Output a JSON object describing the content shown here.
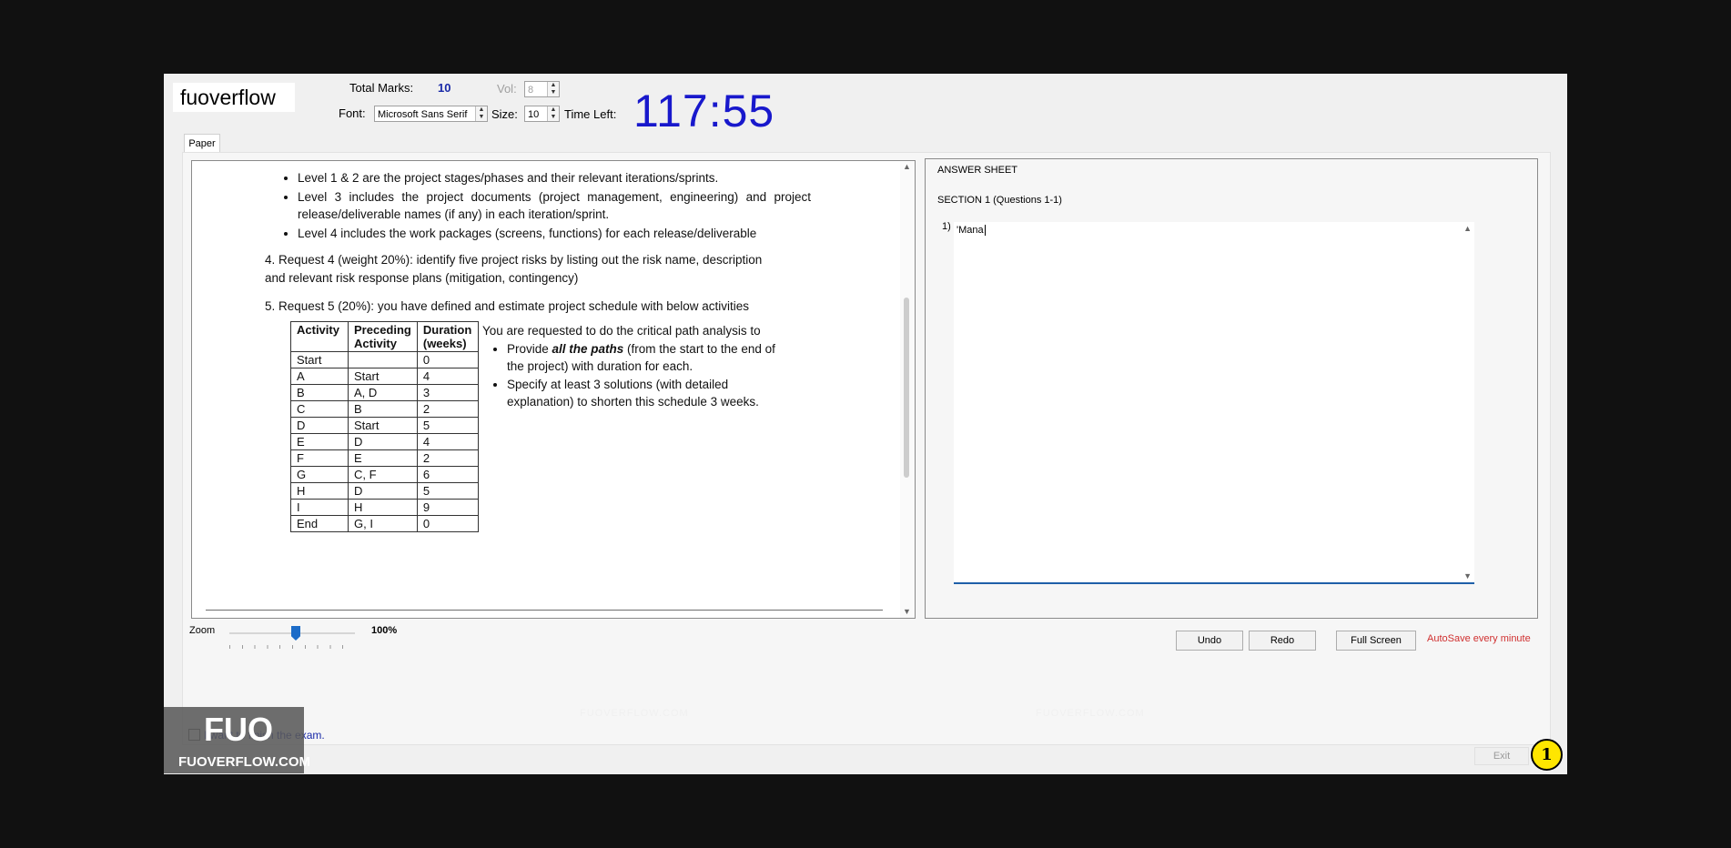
{
  "header": {
    "brand": "fuoverflow",
    "total_marks_label": "Total Marks:",
    "total_marks_value": "10",
    "vol_label": "Vol:",
    "vol_value": "8",
    "font_label": "Font:",
    "font_value": "Microsoft Sans Serif",
    "size_label": "Size:",
    "size_value": "10",
    "time_left_label": "Time Left:",
    "timer": "117:55"
  },
  "tabs": {
    "paper": "Paper"
  },
  "paper": {
    "bullets_top": [
      "Level 1 & 2 are the project stages/phases and their relevant iterations/sprints.",
      "Level 3 includes the project documents (project management, engineering) and project release/deliverable names (if any) in each iteration/sprint.",
      "Level 4 includes the work packages (screens, functions) for each release/deliverable"
    ],
    "request4": "4. Request 4 (weight 20%): identify five project risks by listing out the risk name, description and relevant risk response plans (mitigation, contingency)",
    "request5": "5. Request 5 (20%): you have defined and estimate project schedule with below activities",
    "table_headers": [
      "Activity",
      "Preceding Activity",
      "Duration (weeks)"
    ],
    "table_rows": [
      [
        "Start",
        "",
        "0"
      ],
      [
        "A",
        "Start",
        "4"
      ],
      [
        "B",
        "A, D",
        "3"
      ],
      [
        "C",
        "B",
        "2"
      ],
      [
        "D",
        "Start",
        "5"
      ],
      [
        "E",
        "D",
        "4"
      ],
      [
        "F",
        "E",
        "2"
      ],
      [
        "G",
        "C, F",
        "6"
      ],
      [
        "H",
        "D",
        "5"
      ],
      [
        "I",
        "H",
        "9"
      ],
      [
        "End",
        "G, I",
        "0"
      ]
    ],
    "cpa_intro": "You are requested to do the critical path analysis to",
    "cpa_b1_pre": "Provide ",
    "cpa_b1_em": "all the paths",
    "cpa_b1_post": " (from the start to the end of the project) with duration for each.",
    "cpa_b2": "Specify at least 3 solutions (with detailed explanation) to shorten this schedule 3 weeks."
  },
  "zoom": {
    "label": "Zoom",
    "value": "100%",
    "level_percent": 100
  },
  "answer_sheet": {
    "title": "ANSWER SHEET",
    "section": "SECTION 1 (Questions 1-1)",
    "question_number": "1)",
    "answer_text": "'Mana"
  },
  "buttons": {
    "undo": "Undo",
    "redo": "Redo",
    "full_screen": "Full Screen",
    "exit": "Exit"
  },
  "autosave": "AutoSave every minute",
  "finish_text": "I want to finish the exam.",
  "logo": {
    "main": "FUO",
    "sub": "FUOVERFLOW.COM"
  },
  "watermark": "FUOVERFLOW.COM",
  "badge": "1",
  "colors": {
    "timer": "#1818cc",
    "autosave": "#d03030",
    "accent": "#1e5fa8",
    "badge": "#ffe600"
  }
}
